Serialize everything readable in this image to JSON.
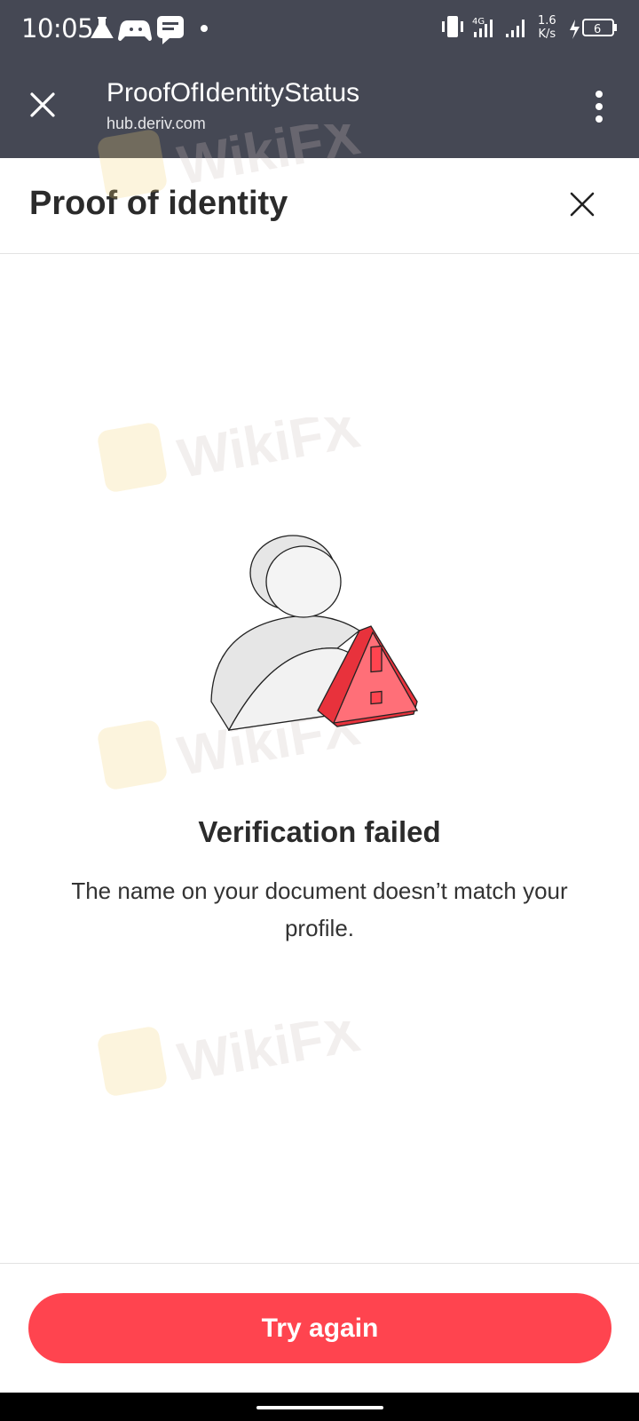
{
  "status_bar": {
    "time": "10:05",
    "speed_value": "1.6",
    "speed_unit": "K/s",
    "battery": "6",
    "network": "4G"
  },
  "titlebar": {
    "title": "ProofOfIdentityStatus",
    "url": "hub.deriv.com"
  },
  "modal": {
    "title": "Proof of identity"
  },
  "status": {
    "title": "Verification failed",
    "message": "The name on your document doesn’t match your profile."
  },
  "footer": {
    "button_label": "Try again"
  },
  "watermark": {
    "text": "WikiFX"
  },
  "colors": {
    "accent": "#ff444f",
    "appbar": "#454854",
    "text": "#2b2b2b"
  }
}
